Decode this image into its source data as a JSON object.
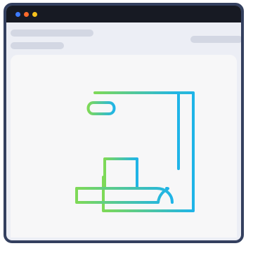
{
  "window": {
    "traffic_lights": [
      {
        "name": "close",
        "color": "#3d7bff"
      },
      {
        "name": "minimize",
        "color": "#ff6a2b"
      },
      {
        "name": "maximize",
        "color": "#f6c21c"
      }
    ],
    "frame_color": "#34405f",
    "titlebar_color": "#171a23"
  },
  "toolbar": {
    "placeholders": [
      "skeleton-line",
      "skeleton-line",
      "skeleton-line"
    ]
  },
  "main": {
    "illustration": {
      "icon": "document-scroll-icon",
      "gradient_start": "#7ed957",
      "gradient_end": "#1fb4e8"
    }
  }
}
